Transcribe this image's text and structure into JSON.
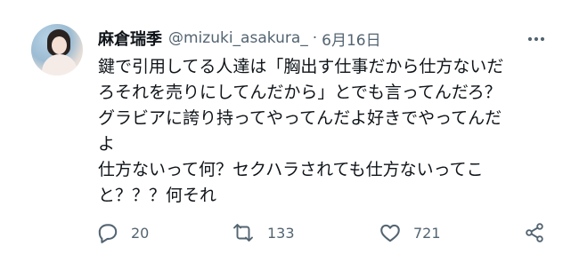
{
  "tweet": {
    "display_name": "麻倉瑞季",
    "handle": "@mizuki_asakura_",
    "separator": "·",
    "date": "6月16日",
    "text_lines": [
      "鍵で引用してる人達は「胸出す仕事だから仕方ないだ",
      "ろそれを売りにしてんだから」とでも言ってんだろ？",
      "グラビアに誇り持ってやってんだよ好きでやってんだ",
      "よ",
      "仕方ないって何？セクハラされても仕方ないってこ",
      "と？？？何それ"
    ]
  },
  "actions": {
    "reply_icon": "reply-icon",
    "reply_count": "20",
    "retweet_icon": "retweet-icon",
    "retweet_count": "133",
    "like_icon": "heart-icon",
    "like_count": "721",
    "share_icon": "share-icon",
    "more_icon": "more-icon"
  },
  "colors": {
    "text_primary": "#0f1419",
    "text_secondary": "#536471",
    "background": "#ffffff"
  }
}
